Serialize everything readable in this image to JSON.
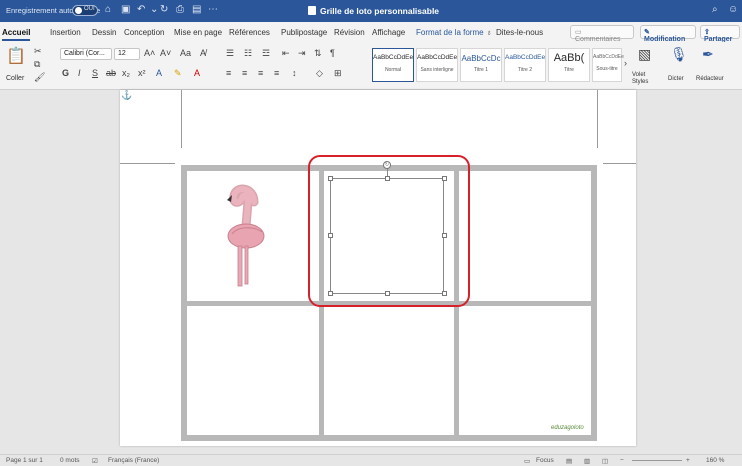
{
  "titlebar": {
    "autosave_label": "Enregistrement automatique",
    "toggle_text": "OUI",
    "doc_title": "Grille de loto personnalisable"
  },
  "tabs": [
    {
      "label": "Accueil"
    },
    {
      "label": "Insertion"
    },
    {
      "label": "Dessin"
    },
    {
      "label": "Conception"
    },
    {
      "label": "Mise en page"
    },
    {
      "label": "Références"
    },
    {
      "label": "Publipostage"
    },
    {
      "label": "Révision"
    },
    {
      "label": "Affichage"
    },
    {
      "label": "Format de la forme"
    },
    {
      "label": "Dites-le-nous"
    }
  ],
  "tab_actions": {
    "comments": "Commentaires",
    "modification": "Modification",
    "share": "Partager"
  },
  "ribbon": {
    "paste_label": "Coller",
    "font_name": "Calibri (Cor...",
    "font_size": "12",
    "styles": [
      {
        "preview": "AaBbCcDdEe",
        "name": "Normal"
      },
      {
        "preview": "AaBbCcDdEe",
        "name": "Sans interligne"
      },
      {
        "preview": "AaBbCcDc",
        "name": "Titre 1"
      },
      {
        "preview": "AaBbCcDdEe",
        "name": "Titre 2"
      },
      {
        "preview": "AaBb(",
        "name": "Titre"
      },
      {
        "preview": "AaBbCcDdEe",
        "name": "Sous-titre"
      }
    ],
    "styles_pane": "Volet Styles",
    "dictate": "Dicter",
    "editor": "Rédacteur"
  },
  "document": {
    "watermark": "eduzagoloto"
  },
  "statusbar": {
    "page": "Page 1 sur 1",
    "words": "0 mots",
    "language": "Français (France)",
    "focus": "Focus",
    "zoom": "160 %"
  }
}
